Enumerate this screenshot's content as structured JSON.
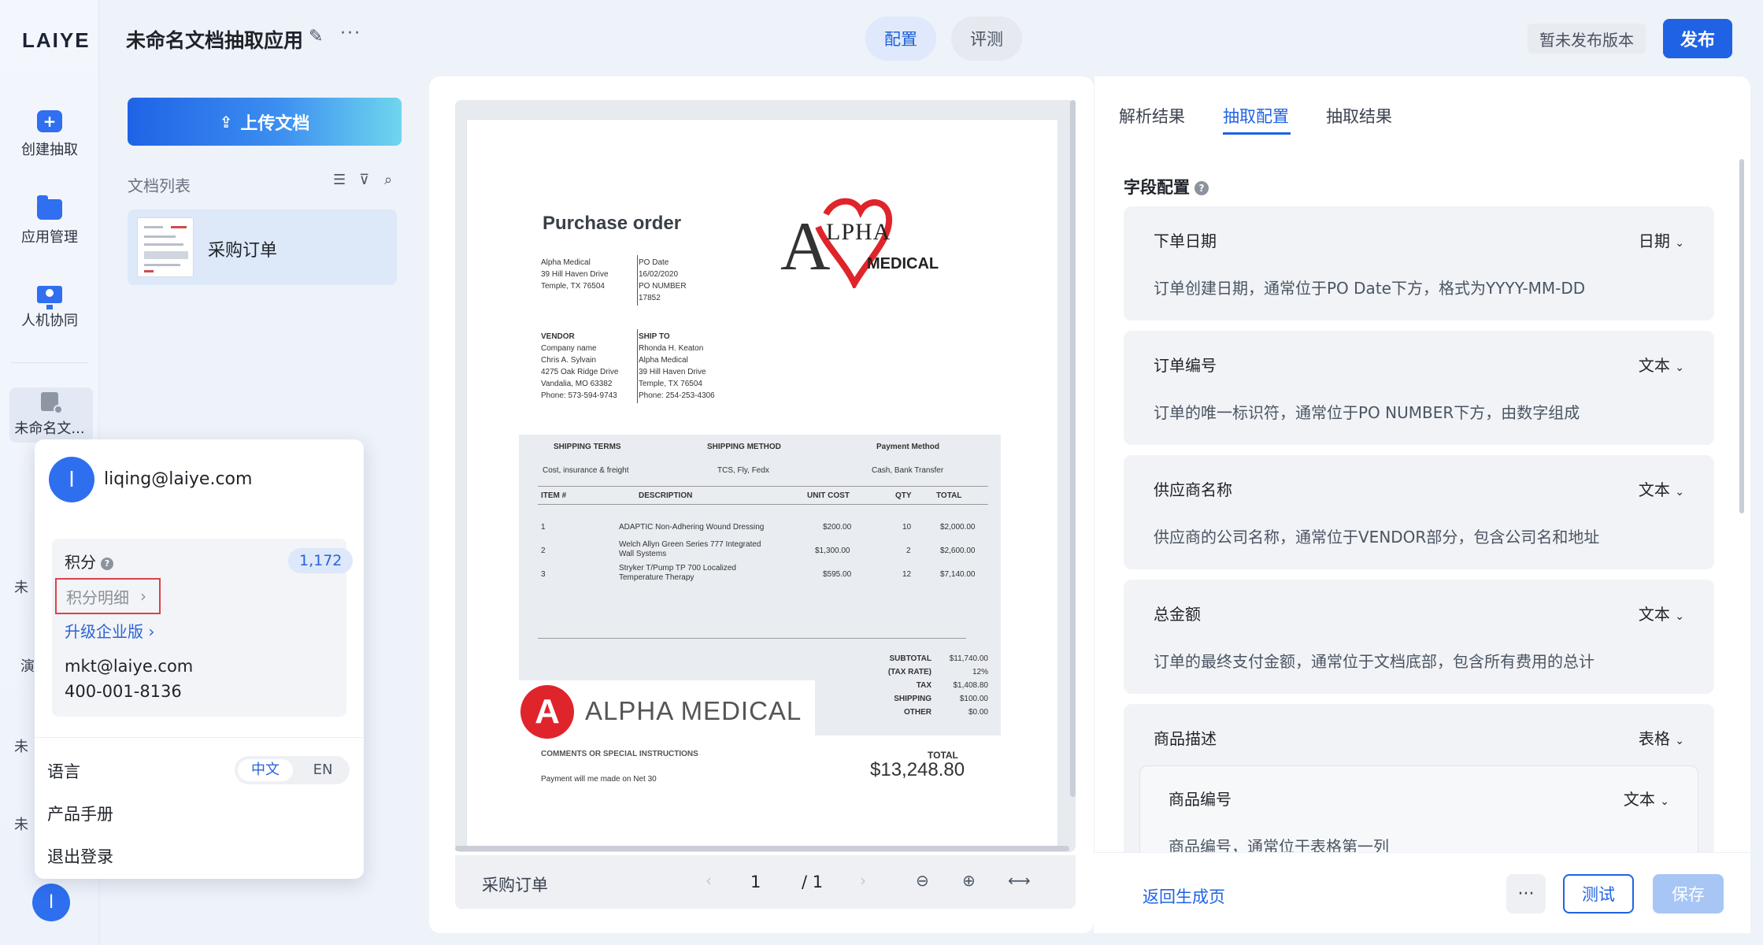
{
  "brand": {
    "logo": "LAIYE"
  },
  "rail": {
    "items": [
      {
        "label": "创建抽取"
      },
      {
        "label": "应用管理"
      },
      {
        "label": "人机协同"
      },
      {
        "label": "未命名文..."
      }
    ],
    "peek_labels": [
      "未",
      "演",
      "未",
      "未"
    ],
    "avatar_initial": "l"
  },
  "header": {
    "title": "未命名文档抽取应用",
    "tabs": [
      {
        "label": "配置",
        "active": true
      },
      {
        "label": "评测",
        "active": false
      }
    ],
    "version_status": "暂未发布版本",
    "publish_label": "发布"
  },
  "doclist": {
    "upload_label": "上传文档",
    "title": "文档列表",
    "items": [
      {
        "name": "采购订单"
      }
    ]
  },
  "document": {
    "title": "Purchase order",
    "logo_text_top": "LPHA",
    "logo_letter": "A",
    "logo_text_bottom": "MEDICAL",
    "buyer": {
      "name": "Alpha Medical",
      "addr1": "39 Hill Haven Drive",
      "addr2": "Temple, TX 76504"
    },
    "po": {
      "date_label": "PO Date",
      "date": "16/02/2020",
      "number_label": "PO NUMBER",
      "number": "17852"
    },
    "vendor": {
      "label": "VENDOR",
      "lines": [
        "Company name",
        "Chris A. Sylvain",
        "4275 Oak Ridge Drive",
        "Vandalia, MO 63382",
        "Phone: 573-594-9743"
      ]
    },
    "ship_to": {
      "label": "SHIP TO",
      "lines": [
        "Rhonda H. Keaton",
        "Alpha Medical",
        "39 Hill Haven Drive",
        "Temple, TX 76504",
        "Phone: 254-253-4306"
      ]
    },
    "terms": {
      "headers": [
        "SHIPPING TERMS",
        "SHIPPING METHOD",
        "Payment Method"
      ],
      "values": [
        "Cost, insurance & freight",
        "TCS, Fly, Fedx",
        "Cash, Bank Transfer"
      ]
    },
    "items_header": [
      "ITEM #",
      "DESCRIPTION",
      "UNIT COST",
      "QTY",
      "TOTAL"
    ],
    "items": [
      {
        "no": "1",
        "desc": "ADAPTIC Non-Adhering Wound Dressing",
        "desc2": "",
        "unit": "$200.00",
        "qty": "10",
        "total": "$2,000.00"
      },
      {
        "no": "2",
        "desc": "Welch Allyn Green Series 777 Integrated",
        "desc2": "Wall Systems",
        "unit": "$1,300.00",
        "qty": "2",
        "total": "$2,600.00"
      },
      {
        "no": "3",
        "desc": "Stryker T/Pump TP 700 Localized",
        "desc2": "Temperature Therapy",
        "unit": "$595.00",
        "qty": "12",
        "total": "$7,140.00"
      }
    ],
    "summary": [
      {
        "label": "SUBTOTAL",
        "value": "$11,740.00"
      },
      {
        "label": "(TAX RATE)",
        "value": "12%"
      },
      {
        "label": "TAX",
        "value": "$1,408.80"
      },
      {
        "label": "SHIPPING",
        "value": "$100.00"
      },
      {
        "label": "OTHER",
        "value": "$0.00"
      }
    ],
    "banner_letter": "A",
    "banner_text": "ALPHA MEDICAL",
    "comments_label": "COMMENTS OR SPECIAL INSTRUCTIONS",
    "comments": "Payment will me made on Net 30",
    "total_label": "TOTAL",
    "total": "$13,248.80"
  },
  "pager": {
    "doc_name": "采购订单",
    "prev": "‹",
    "current": "1",
    "of": "/ 1",
    "next": "›",
    "zoom_out": "⊖",
    "zoom_in": "⊕",
    "fit": "⟷"
  },
  "config": {
    "tabs": [
      {
        "label": "解析结果"
      },
      {
        "label": "抽取配置",
        "active": true
      },
      {
        "label": "抽取结果"
      }
    ],
    "section_title": "字段配置",
    "help": "?",
    "fields": [
      {
        "name": "下单日期",
        "type": "日期",
        "desc": "订单创建日期，通常位于PO Date下方，格式为YYYY-MM-DD"
      },
      {
        "name": "订单编号",
        "type": "文本",
        "desc": "订单的唯一标识符，通常位于PO NUMBER下方，由数字组成"
      },
      {
        "name": "供应商名称",
        "type": "文本",
        "desc": "供应商的公司名称，通常位于VENDOR部分，包含公司名和地址"
      },
      {
        "name": "总金额",
        "type": "文本",
        "desc": "订单的最终支付金额，通常位于文档底部，包含所有费用的总计"
      },
      {
        "name": "商品描述",
        "type": "表格",
        "desc": ""
      }
    ],
    "sub_field": {
      "name": "商品编号",
      "type": "文本",
      "desc": "商品编号，通常位于表格第一列"
    },
    "back_label": "返回生成页",
    "more_label": "···",
    "test_label": "测试",
    "save_label": "保存"
  },
  "popup": {
    "avatar_initial": "l",
    "email": "liqing@laiye.com",
    "points_label": "积分",
    "points_value": "1,172",
    "points_detail": "积分明细",
    "upgrade": "升级企业版",
    "contact_email": "mkt@laiye.com",
    "contact_phone": "400-001-8136",
    "language_label": "语言",
    "lang_zh": "中文",
    "lang_en": "EN",
    "manual": "产品手册",
    "logout": "退出登录"
  },
  "colors": {
    "accent": "#1f63e4",
    "danger": "#d9434a",
    "logo_red": "#e0242b"
  }
}
